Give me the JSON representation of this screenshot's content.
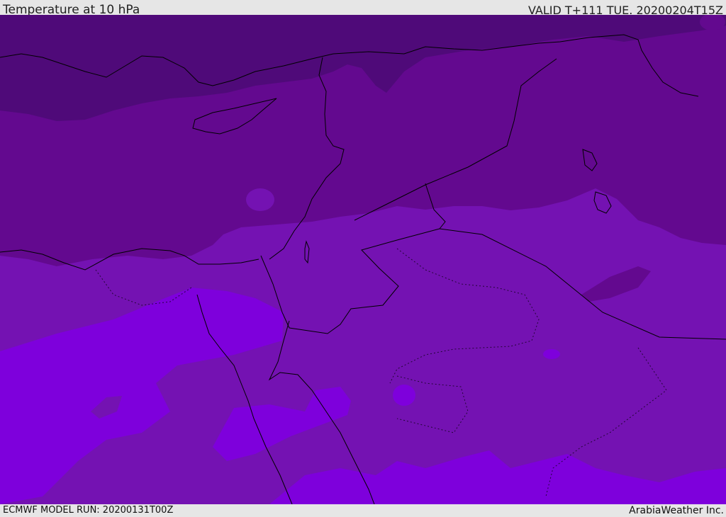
{
  "header": {
    "title": "Temperature at 10 hPa",
    "valid_time": "VALID T+111 TUE. 20200204T15Z"
  },
  "footer": {
    "model_run": "ECMWF MODEL RUN: 20200131T00Z",
    "credit": "ArabiaWeather Inc."
  },
  "map": {
    "variable": "temperature",
    "level": "10 hPa",
    "colors": {
      "coldest": "#4f0a79",
      "cold": "#63098f",
      "mid": "#7412b2",
      "warm": "#7e00dc",
      "coastline": "#000000",
      "border": "#000000"
    }
  }
}
